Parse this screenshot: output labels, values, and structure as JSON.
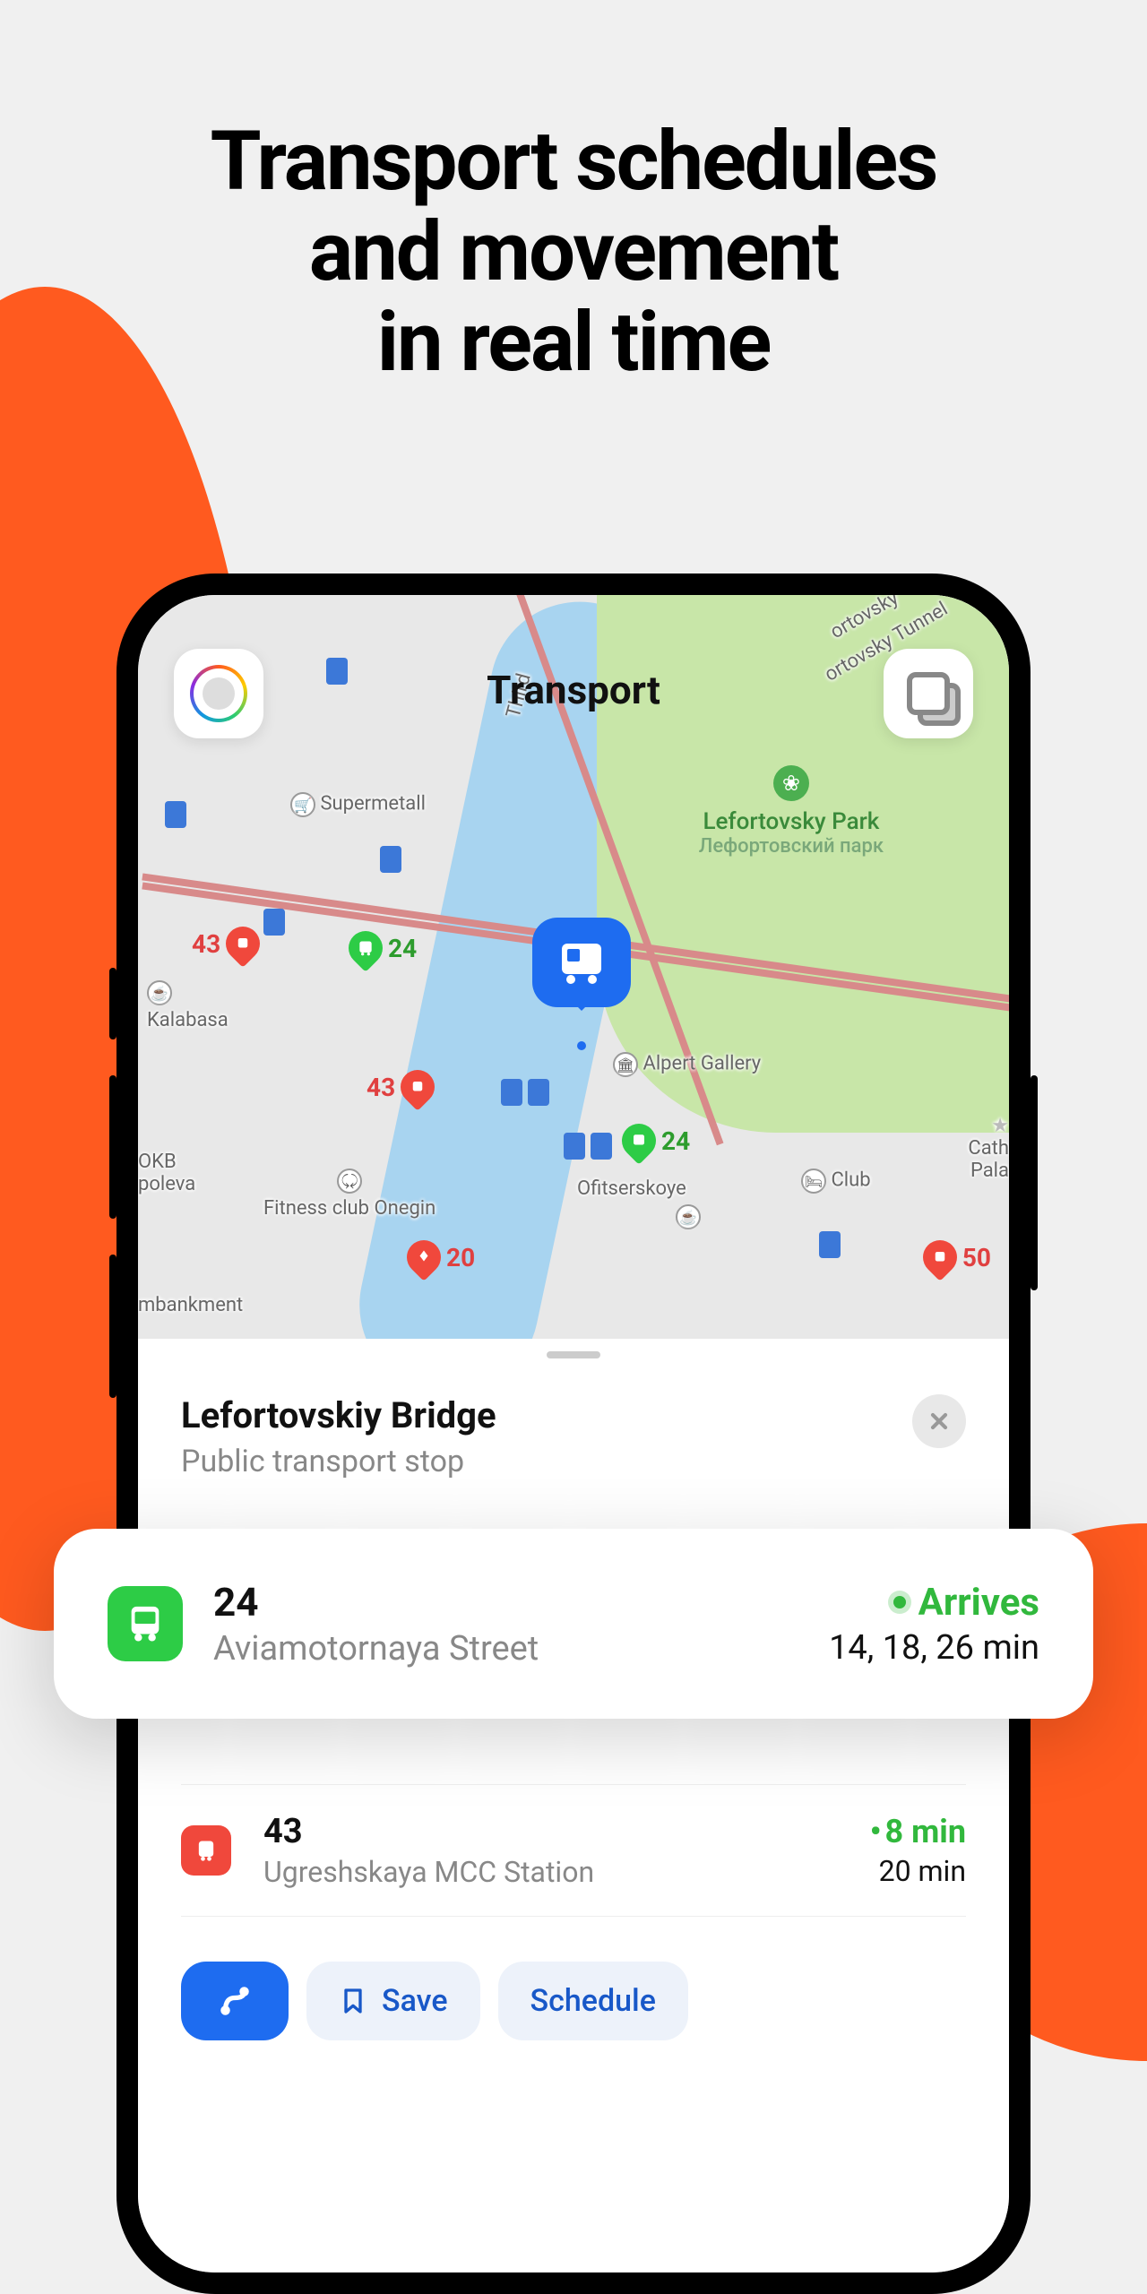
{
  "headline": {
    "line1": "Transport schedules",
    "line2": "and movement",
    "line3": "in real time"
  },
  "map": {
    "title": "Transport",
    "park": {
      "name_en": "Lefortovsky Park",
      "name_ru": "Лефортовский парк"
    },
    "poi": {
      "supermetall": "Supermetall",
      "kalabasa": "Kalabasa",
      "okb": "OKB",
      "poleva": "poleva",
      "fitness": "Fitness club Onegin",
      "alpert": "Alpert Gallery",
      "ofitserskoye": "Ofitserskoye",
      "club": "Club",
      "embankment": "mbankment",
      "cathedral": "Cath",
      "pala": "Pala",
      "tunnel": "ortovsky Tunnel",
      "tunnel2": "ortovsky",
      "third": "Third"
    },
    "pins": {
      "a": "24",
      "b": "43",
      "c": "43",
      "d": "24",
      "e": "20",
      "f": "50"
    }
  },
  "stop": {
    "name": "Lefortovskiy Bridge",
    "subtitle": "Public transport stop"
  },
  "routes": [
    {
      "number": "24",
      "destination": "Aviamotornaya Street",
      "arrives_label": "Arrives",
      "minutes": "14, 18, 26 min"
    },
    {
      "number": "43",
      "destination": "Ugreshskaya MCC Station",
      "primary": "8 min",
      "secondary": "20 min"
    }
  ],
  "actions": {
    "save": "Save",
    "schedule": "Schedule"
  }
}
